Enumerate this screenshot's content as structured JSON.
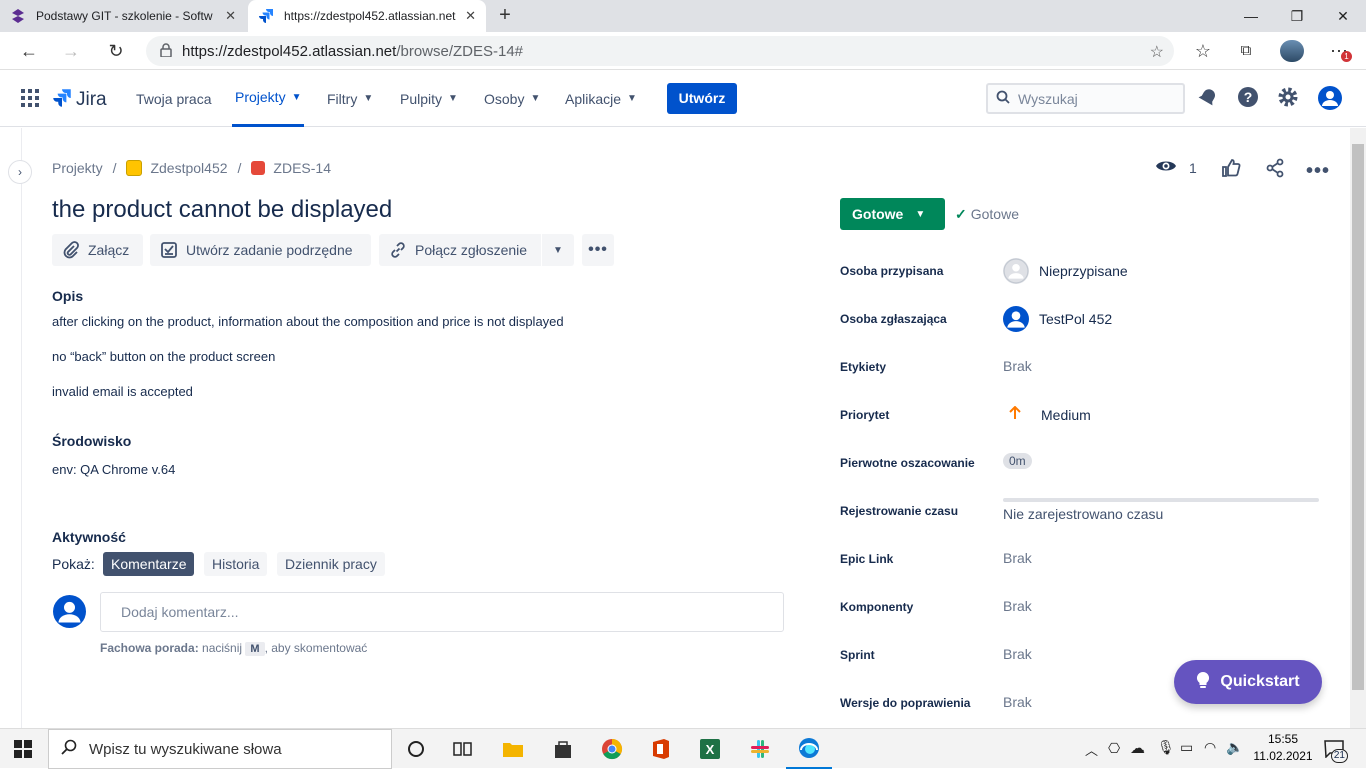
{
  "browser": {
    "tabs": [
      {
        "title": "Podstawy GIT - szkolenie - Softw",
        "icon": "softwaremill-icon",
        "active": false
      },
      {
        "title": "https://zdestpol452.atlassian.net",
        "icon": "jira-icon",
        "active": true
      }
    ],
    "url_host": "https://zdestpol452.atlassian.net",
    "url_path": "/browse/ZDES-14#",
    "notification_badge": "1"
  },
  "jira_nav": {
    "logo": "Jira",
    "items": [
      {
        "label": "Twoja praca",
        "dropdown": false,
        "selected": false
      },
      {
        "label": "Projekty",
        "dropdown": true,
        "selected": true
      },
      {
        "label": "Filtry",
        "dropdown": true,
        "selected": false
      },
      {
        "label": "Pulpity",
        "dropdown": true,
        "selected": false
      },
      {
        "label": "Osoby",
        "dropdown": true,
        "selected": false
      },
      {
        "label": "Aplikacje",
        "dropdown": true,
        "selected": false
      }
    ],
    "create_label": "Utwórz",
    "search_placeholder": "Wyszukaj"
  },
  "breadcrumb": {
    "root": "Projekty",
    "project": "Zdestpol452",
    "issue_key": "ZDES-14"
  },
  "issue": {
    "title": "the product cannot be displayed",
    "watchers": "1",
    "actions": {
      "attach": "Załącz",
      "subtask": "Utwórz zadanie podrzędne",
      "link": "Połącz zgłoszenie"
    },
    "description_heading": "Opis",
    "description_lines": [
      "after clicking on the product, information about the composition and price is not displayed",
      "no “back” button on the product screen",
      "invalid email is accepted"
    ],
    "environment_heading": "Środowisko",
    "environment": "env: QA Chrome v.64"
  },
  "activity": {
    "heading": "Aktywność",
    "show_label": "Pokaż:",
    "tabs": [
      "Komentarze",
      "Historia",
      "Dziennik pracy"
    ],
    "active_tab": "Komentarze",
    "comment_placeholder": "Dodaj komentarz...",
    "tip_bold": "Fachowa porada:",
    "tip_pre": "naciśnij",
    "tip_key": "M",
    "tip_post": ", aby skomentować"
  },
  "status": {
    "button": "Gotowe",
    "resolution": "Gotowe",
    "color": "#00875a"
  },
  "fields": {
    "assignee": {
      "label": "Osoba przypisana",
      "value": "Nieprzypisane"
    },
    "reporter": {
      "label": "Osoba zgłaszająca",
      "value": "TestPol 452"
    },
    "labels": {
      "label": "Etykiety",
      "value": "Brak"
    },
    "priority": {
      "label": "Priorytet",
      "value": "Medium"
    },
    "estimate": {
      "label": "Pierwotne oszacowanie",
      "value": "0m"
    },
    "timetracking": {
      "label": "Rejestrowanie czasu",
      "value": "Nie zarejestrowano czasu"
    },
    "epic": {
      "label": "Epic Link",
      "value": "Brak"
    },
    "components": {
      "label": "Komponenty",
      "value": "Brak"
    },
    "sprint": {
      "label": "Sprint",
      "value": "Brak"
    },
    "fixversions": {
      "label": "Wersje do poprawienia",
      "value": "Brak"
    }
  },
  "quickstart_label": "Quickstart",
  "taskbar": {
    "search_placeholder": "Wpisz tu wyszukiwane słowa",
    "time": "15:55",
    "date": "11.02.2021",
    "notifications": "21"
  }
}
